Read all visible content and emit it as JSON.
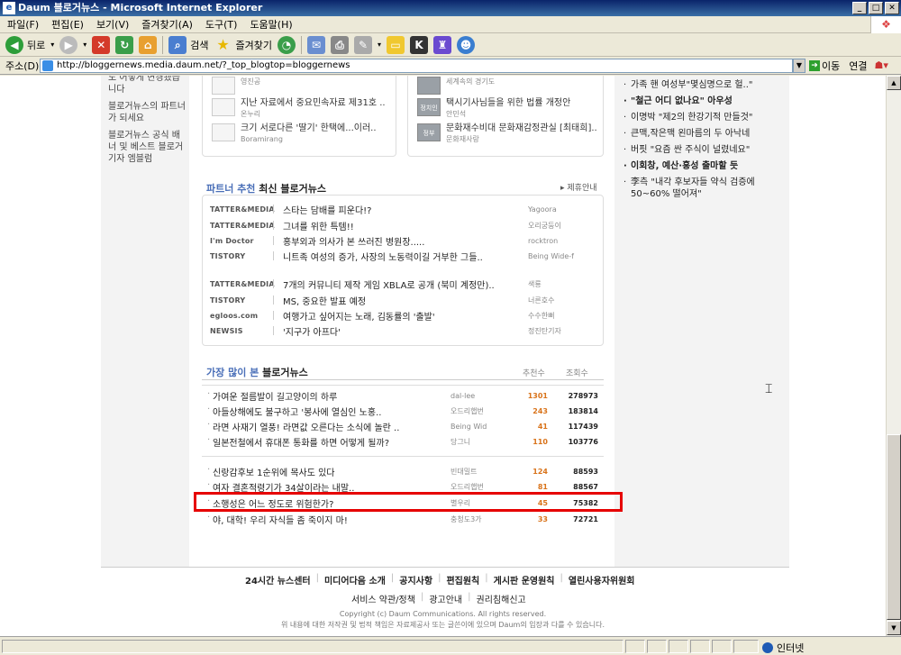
{
  "window": {
    "title": "Daum 블로거뉴스 - Microsoft Internet Explorer"
  },
  "menu": [
    "파일(F)",
    "편집(E)",
    "보기(V)",
    "즐겨찾기(A)",
    "도구(T)",
    "도움말(H)"
  ],
  "toolbar": {
    "back": "뒤로",
    "search": "검색",
    "favorites": "즐겨찾기"
  },
  "address": {
    "label": "주소(D)",
    "url": "http://bloggernews.media.daum.net/?_top_blogtop=bloggernews",
    "go": "이동",
    "links": "연결"
  },
  "status": {
    "zone": "인터넷"
  },
  "left_links": [
    "도 어떻게 변경됐습니다",
    "블로거뉴스의 파트너가 되세요",
    "블로거뉴스 공식 배너 및 베스트 블로거 기자 엠블럼"
  ],
  "top_left_items": [
    {
      "thumb": "",
      "title": "",
      "sub": "영진공"
    },
    {
      "thumb": "",
      "title": "지난 자료에서 중요민속자료 제31호 ..",
      "sub": "온누리"
    },
    {
      "thumb": "",
      "title": "크기 서로다른 '딸기' 한택에...이러..",
      "sub": "Boramirang"
    }
  ],
  "top_right_items": [
    {
      "thumb": "",
      "title": "",
      "sub": "세계속의 경기도"
    },
    {
      "thumb": "정치인",
      "title": "택시기사님들을 위한 법률 개정안",
      "sub": "안민석"
    },
    {
      "thumb": "정부",
      "title": "문화재수비대 문화재감정관실 [최태희]..",
      "sub": "문화재사랑"
    }
  ],
  "right_list": [
    {
      "text": "가족 핸 여성부\"몇심명으로 헐..\"",
      "bold": false
    },
    {
      "text": "\"철근 어디 없나요\" 아우성",
      "bold": true
    },
    {
      "text": "이명박 \"제2의 한강기적 만들것\"",
      "bold": false
    },
    {
      "text": "큰맥,작은맥 왼마름의 두 아낙네",
      "bold": false
    },
    {
      "text": "버핏 \"요즘 싼 주식이 널렸네요\"",
      "bold": false
    },
    {
      "text": "이회창, 예산·홍성 출마할 듯",
      "bold": true
    },
    {
      "text": "李측 \"내각 후보자들 약식 검증에 50~60% 떨어져\"",
      "bold": false
    }
  ],
  "partner": {
    "title_highlight": "파트너 추천",
    "title_rest": " 최신 블로거뉴스",
    "more": "▸ 제휴안내",
    "rows": [
      {
        "logo": "TATTER&MEDIA",
        "title": "스타는 담배를 피운다!?",
        "author": "Yagoora"
      },
      {
        "logo": "TATTER&MEDIA",
        "title": "그녀를 위한 특템!!",
        "author": "오리궁둥이"
      },
      {
        "logo": "I'm Doctor",
        "title": "홍부외과 의사가 본 쓰러진 병원장.....",
        "author": "rocktron"
      },
      {
        "logo": "TISTORY",
        "title": "니트족 여성의 증가, 사장의 노동력이길 거부한 그들..",
        "author": "Being Wide-f"
      },
      {
        "logo": "TATTER&MEDIA",
        "title": "7개의 커뮤니티 제작 게임 XBLA로 공개 (북미 계정만)..",
        "author": "색룡"
      },
      {
        "logo": "TISTORY",
        "title": "MS, 중요한 발표 예정",
        "author": "너른호수"
      },
      {
        "logo": "egloos.com",
        "title": "여행가고 싶어지는 노래, 김동률의 '출발'",
        "author": "수수한뻐"
      },
      {
        "logo": "NEWSIS",
        "title": "'지구가 아프다'",
        "author": "정진탄기자"
      }
    ]
  },
  "most_viewed": {
    "title_highlight": "가장 많이 본",
    "title_rest": " 블로거뉴스",
    "col_rec": "추천수",
    "col_views": "조회수",
    "rows": [
      {
        "title": "가여운 절름발이 길고양이의 하루",
        "author": "dal-lee",
        "rec": "1301",
        "views": "278973"
      },
      {
        "title": "아들상해에도 불구하고 '봉사에 열심인 노홍..",
        "author": "오드리햅번",
        "rec": "243",
        "views": "183814"
      },
      {
        "title": "라면 사재기 열풍! 라면값 오른다는 소식에 놀란 ..",
        "author": "Being Wid",
        "rec": "41",
        "views": "117439"
      },
      {
        "title": "일본전철에서 휴대폰 통화를 하면 어떻게 될까?",
        "author": "당그니",
        "rec": "110",
        "views": "103776"
      },
      {
        "title": "신랑감후보 1순위에 목사도 있다",
        "author": "빈대밀트",
        "rec": "124",
        "views": "88593"
      },
      {
        "title": "여자 결혼적령기가 34살이라는 내말..",
        "author": "오드리햅번",
        "rec": "81",
        "views": "88567"
      },
      {
        "title": "소행성은 어느 정도로 위험한가?",
        "author": "별우리",
        "rec": "45",
        "views": "75382"
      },
      {
        "title": "야, 대학! 우리 자식들 좀 죽이지 마!",
        "author": "충청도3가",
        "rec": "33",
        "views": "72721"
      }
    ]
  },
  "footer": {
    "links": [
      "24시간 뉴스센터",
      "미디어다음 소개",
      "공지사항",
      "편집원칙",
      "게시판 운영원칙",
      "열린사용자위원회"
    ],
    "links2": [
      "서비스 약관/정책",
      "광고안내",
      "권리침해신고"
    ],
    "copyright": "Copyright (c) Daum Communications. All rights reserved.",
    "disclaimer": "위 내용에 대한 저작권 및 법적 책임은 자료제공사 또는 글쓴이에 있으며 Daum의 입장과 다를 수 있습니다."
  }
}
